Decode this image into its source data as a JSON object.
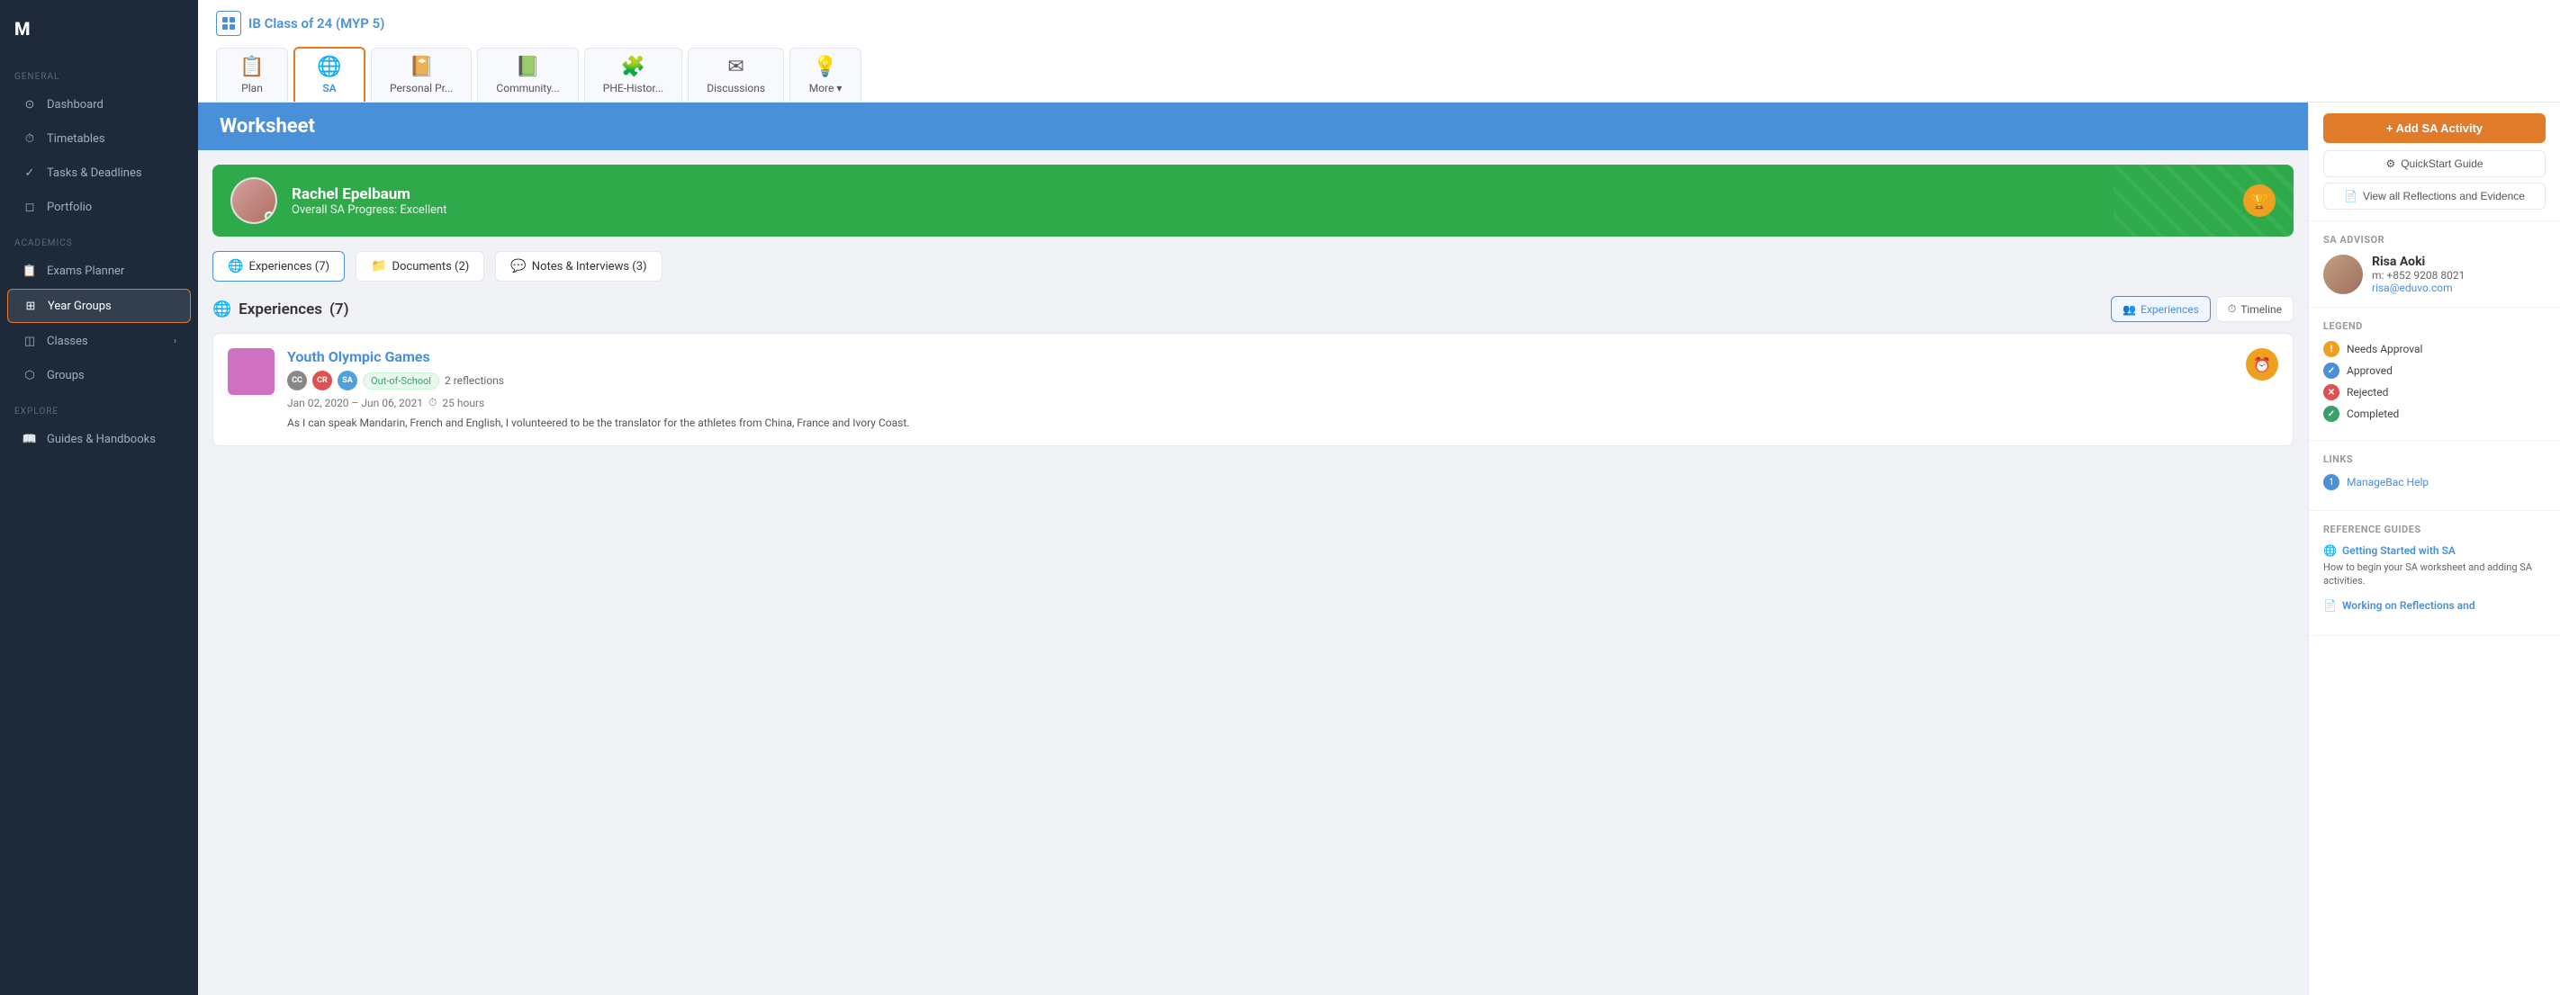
{
  "sidebar": {
    "general_label": "General",
    "academics_label": "Academics",
    "explore_label": "Explore",
    "items": [
      {
        "id": "dashboard",
        "label": "Dashboard",
        "icon": "⊙",
        "active": false
      },
      {
        "id": "timetables",
        "label": "Timetables",
        "icon": "⏱",
        "active": false
      },
      {
        "id": "tasks-deadlines",
        "label": "Tasks & Deadlines",
        "icon": "✓",
        "active": false
      },
      {
        "id": "portfolio",
        "label": "Portfolio",
        "icon": "◻",
        "active": false
      },
      {
        "id": "exams-planner",
        "label": "Exams Planner",
        "icon": "📋",
        "active": false
      },
      {
        "id": "year-groups",
        "label": "Year Groups",
        "icon": "⊞",
        "active": true
      },
      {
        "id": "classes",
        "label": "Classes",
        "icon": "◫",
        "active": false,
        "arrow": "›"
      },
      {
        "id": "groups",
        "label": "Groups",
        "icon": "⬡",
        "active": false
      },
      {
        "id": "guides-handbooks",
        "label": "Guides & Handbooks",
        "icon": "📖",
        "active": false
      }
    ]
  },
  "header": {
    "class_title": "IB Class of 24 (MYP 5)"
  },
  "tabs": [
    {
      "id": "plan",
      "label": "Plan",
      "icon": "📋"
    },
    {
      "id": "sa",
      "label": "SA",
      "icon": "🌐",
      "active": true
    },
    {
      "id": "personal-pr",
      "label": "Personal Pr...",
      "icon": "📔"
    },
    {
      "id": "community",
      "label": "Community...",
      "icon": "📗"
    },
    {
      "id": "phe-histor",
      "label": "PHE-Histor...",
      "icon": "🧩"
    },
    {
      "id": "discussions",
      "label": "Discussions",
      "icon": "✉"
    },
    {
      "id": "more",
      "label": "More ▾",
      "icon": "💡"
    }
  ],
  "worksheet": {
    "title": "Worksheet"
  },
  "student": {
    "name": "Rachel Epelbaum",
    "progress_label": "Overall SA Progress: Excellent"
  },
  "filter_tabs": [
    {
      "id": "experiences",
      "label": "Experiences (7)",
      "icon": "🌐",
      "active": true
    },
    {
      "id": "documents",
      "label": "Documents (2)",
      "icon": "📁"
    },
    {
      "id": "notes-interviews",
      "label": "Notes & Interviews (3)",
      "icon": "💬"
    }
  ],
  "experiences_section": {
    "title": "Experiences",
    "count": "(7)",
    "views": [
      {
        "id": "experiences",
        "label": "Experiences",
        "icon": "👥",
        "active": true
      },
      {
        "id": "timeline",
        "label": "Timeline",
        "icon": "⏱"
      }
    ]
  },
  "activity": {
    "title": "Youth Olympic Games",
    "tags": [
      "CC",
      "CR",
      "SA"
    ],
    "tag_pill": "Out-of-School",
    "reflections": "2 reflections",
    "date_range": "Jan 02, 2020 – Jun 06, 2021",
    "hours": "25 hours",
    "description": "As I can speak Mandarin, French and English, I volunteered to be the translator for the athletes from China, France and Ivory Coast."
  },
  "right_sidebar": {
    "add_sa_label": "+ Add SA Activity",
    "quickstart_label": "QuickStart Guide",
    "view_reflections_label": "View all Reflections and Evidence",
    "advisor_section_label": "SA Advisor",
    "advisor": {
      "name": "Risa Aoki",
      "phone": "m: +852 9208 8021",
      "email": "risa@eduvo.com"
    },
    "legend_label": "Legend",
    "legend_items": [
      {
        "id": "needs-approval",
        "label": "Needs Approval",
        "color": "#f0a020",
        "symbol": "!"
      },
      {
        "id": "approved",
        "label": "Approved",
        "color": "#4a90d9",
        "symbol": "✓"
      },
      {
        "id": "rejected",
        "label": "Rejected",
        "color": "#e05050",
        "symbol": "✕"
      },
      {
        "id": "completed",
        "label": "Completed",
        "color": "#38a169",
        "symbol": "✓"
      }
    ],
    "links_label": "Links",
    "links": [
      {
        "id": "managebac-help",
        "label": "ManageBac Help",
        "num": "1"
      }
    ],
    "reference_guides_label": "Reference Guides",
    "guides": [
      {
        "id": "getting-started",
        "label": "Getting Started with SA",
        "description": "How to begin your SA worksheet and adding SA activities."
      },
      {
        "id": "working-on-reflections",
        "label": "Working on Reflections and",
        "description": ""
      }
    ]
  }
}
